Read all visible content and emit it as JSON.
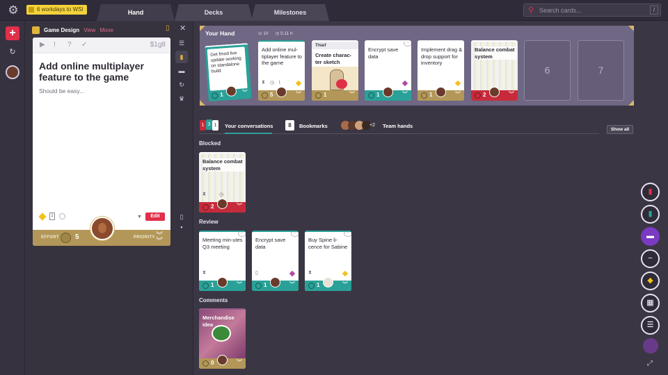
{
  "topbar": {
    "logo_icon": "stacked-cards-logo-icon",
    "wsi_badge": "6 workdays to WSI",
    "tabs": [
      {
        "label": "Hand"
      },
      {
        "label": "Decks"
      },
      {
        "label": "Milestones"
      }
    ],
    "search_placeholder": "Search cards...",
    "search_shortcut": "/"
  },
  "rail": {
    "add_icon": "+",
    "history_icon": "↻"
  },
  "detail": {
    "project": "Game Design",
    "view_label": "View",
    "move_label": "Move",
    "card_code": "$1g8",
    "title": "Add online multiplayer feature to the game",
    "description": "Should be easy...",
    "doc_count": "1",
    "edit_label": "Edit",
    "effort_label": "EFFORT",
    "effort_value": "5",
    "priority_label": "PRIORITY"
  },
  "hand": {
    "label": "Your Hand",
    "count": "10",
    "time": "5:11 h",
    "cards": [
      {
        "title": "Add online mul-tiplayer feature to the game",
        "effort": "5",
        "bar": "gold"
      },
      {
        "tag": "Thief",
        "title": "Create charac-ter sketch",
        "effort": "1",
        "bar": "gold"
      },
      {
        "title": "Encrypt save data",
        "effort": "1",
        "bar": "teal"
      },
      {
        "title": "Implement drag & drop support for inventory",
        "effort": "1",
        "bar": "gold"
      },
      {
        "title": "Balance combat system",
        "effort": "2",
        "bar": "red"
      }
    ],
    "stack_note": "Get fmod live update working on standalone build",
    "stack_effort": "1",
    "empty_slots": [
      "6",
      "7"
    ]
  },
  "conversations": {
    "badges": [
      "1",
      "3",
      "1"
    ],
    "tab_label": "Your conversations",
    "bookmarks_count": "8",
    "bookmarks_label": "Bookmarks",
    "team_more": "+2",
    "team_label": "Team hands",
    "show_all": "Show all"
  },
  "sections": {
    "blocked": {
      "label": "Blocked",
      "cards": [
        {
          "title": "Balance combat system",
          "effort": "2",
          "bar": "red"
        }
      ]
    },
    "review": {
      "label": "Review",
      "cards": [
        {
          "title": "Meeting min-utes Q3 meeting",
          "effort": "1",
          "bar": "teal"
        },
        {
          "title": "Encrypt save data",
          "effort": "1",
          "bar": "teal"
        },
        {
          "title": "Buy Spine li-cence for Sabine",
          "effort": "1",
          "bar": "teal"
        }
      ]
    },
    "comments": {
      "label": "Comments",
      "cards": [
        {
          "title": "Merchandise idea",
          "effort": "0",
          "bar": "gold"
        }
      ]
    }
  },
  "colors": {
    "teal": "#2aa198",
    "gold": "#b29758",
    "red": "#c72b3b",
    "accent": "#e0304a",
    "yellow": "#f2c21c"
  }
}
